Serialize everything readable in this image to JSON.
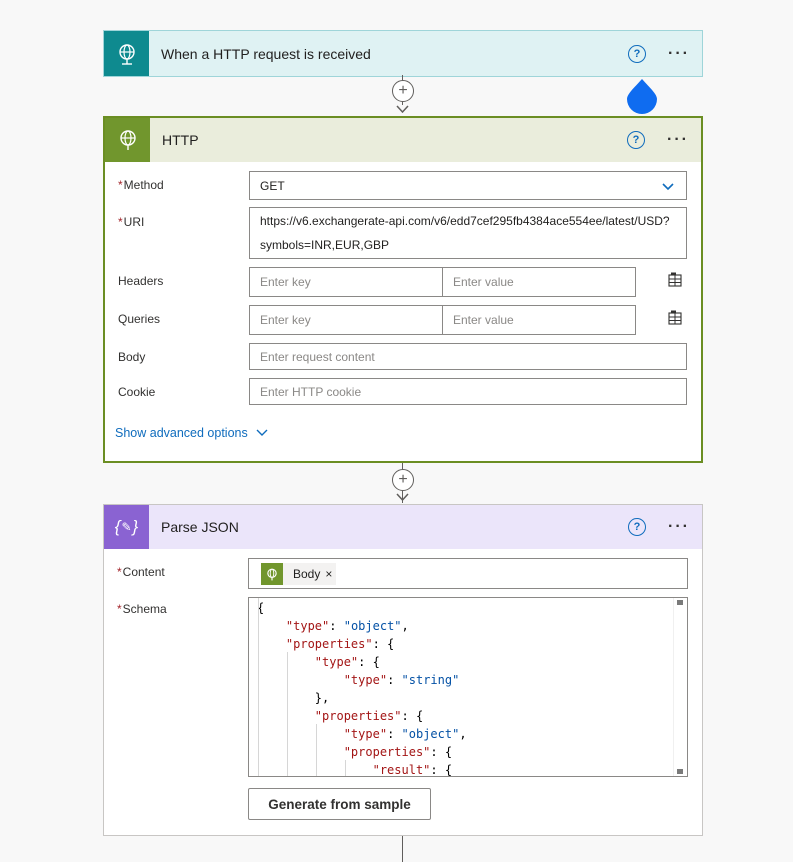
{
  "trigger": {
    "title": "When a HTTP request is received",
    "icon": "globe-request-icon"
  },
  "http": {
    "title": "HTTP",
    "icon": "globe-icon",
    "method": {
      "label": "Method",
      "value": "GET"
    },
    "uri": {
      "label": "URI",
      "line1": "https://v6.exchangerate-api.com/v6/edd7cef295fb4384ace554ee/latest/USD?",
      "line2": "symbols=INR,EUR,GBP"
    },
    "headers": {
      "label": "Headers",
      "key_placeholder": "Enter key",
      "value_placeholder": "Enter value"
    },
    "queries": {
      "label": "Queries",
      "key_placeholder": "Enter key",
      "value_placeholder": "Enter value"
    },
    "body": {
      "label": "Body",
      "placeholder": "Enter request content"
    },
    "cookie": {
      "label": "Cookie",
      "placeholder": "Enter HTTP cookie"
    },
    "advanced_link": "Show advanced options"
  },
  "parse": {
    "title": "Parse JSON",
    "icon": "json-braces-icon",
    "content": {
      "label": "Content",
      "token": "Body",
      "token_remove": "×"
    },
    "schema": {
      "label": "Schema",
      "lines": [
        {
          "t": "{"
        },
        {
          "k": "\"type\"",
          "p": ": ",
          "s": "\"object\"",
          "e": ","
        },
        {
          "k": "\"properties\"",
          "p": ": {"
        },
        {
          "k": "\"type\"",
          "p": ": {"
        },
        {
          "k": "\"type\"",
          "p": ": ",
          "s": "\"string\""
        },
        {
          "t": "},"
        },
        {
          "k": "\"properties\"",
          "p": ": {"
        },
        {
          "k": "\"type\"",
          "p": ": ",
          "s": "\"object\"",
          "e": ","
        },
        {
          "k": "\"properties\"",
          "p": ": {"
        },
        {
          "k": "\"result\"",
          "p": ": {"
        }
      ]
    },
    "generate_button": "Generate from sample"
  },
  "colors": {
    "trigger_accent": "#0e8a8f",
    "http_accent": "#71962d",
    "parse_accent": "#8a63d2",
    "link": "#0f6cbd",
    "required": "#a4262c"
  }
}
